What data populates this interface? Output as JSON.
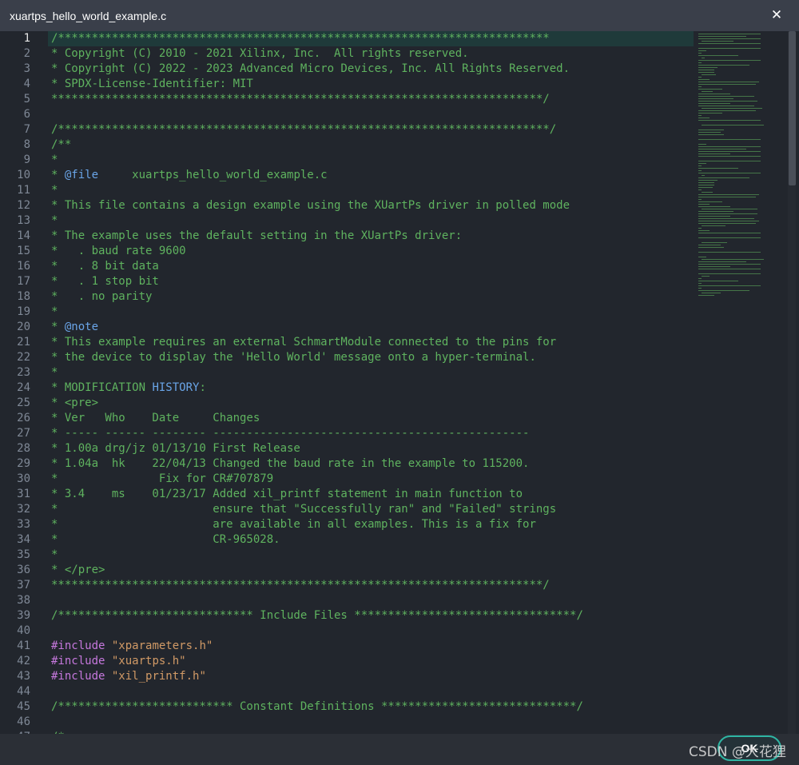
{
  "window": {
    "title": "xuartps_hello_world_example.c",
    "close_icon": "close-icon"
  },
  "editor": {
    "current_line": 1,
    "lines": [
      [
        {
          "t": "/*************************************************************************",
          "c": "comment"
        }
      ],
      [
        {
          "t": "* Copyright (C) 2010 - 2021 Xilinx, Inc.  All rights reserved.",
          "c": "comment"
        }
      ],
      [
        {
          "t": "* Copyright (C) 2022 - 2023 Advanced Micro Devices, Inc. All Rights Reserved.",
          "c": "comment"
        }
      ],
      [
        {
          "t": "* SPDX-License-Identifier: MIT",
          "c": "comment"
        }
      ],
      [
        {
          "t": "*************************************************************************/",
          "c": "comment"
        }
      ],
      [
        {
          "t": "",
          "c": "comment"
        }
      ],
      [
        {
          "t": "/*************************************************************************/",
          "c": "comment"
        }
      ],
      [
        {
          "t": "/**",
          "c": "comment"
        }
      ],
      [
        {
          "t": "*",
          "c": "comment"
        }
      ],
      [
        {
          "t": "* ",
          "c": "comment"
        },
        {
          "t": "@file",
          "c": "tag"
        },
        {
          "t": "     xuartps_hello_world_example.c",
          "c": "comment"
        }
      ],
      [
        {
          "t": "*",
          "c": "comment"
        }
      ],
      [
        {
          "t": "* This file contains a design example using the XUartPs driver in polled mode",
          "c": "comment"
        }
      ],
      [
        {
          "t": "*",
          "c": "comment"
        }
      ],
      [
        {
          "t": "* The example uses the default setting in the XUartPs driver:",
          "c": "comment"
        }
      ],
      [
        {
          "t": "*   . baud rate 9600",
          "c": "comment"
        }
      ],
      [
        {
          "t": "*   . 8 bit data",
          "c": "comment"
        }
      ],
      [
        {
          "t": "*   . 1 stop bit",
          "c": "comment"
        }
      ],
      [
        {
          "t": "*   . no parity",
          "c": "comment"
        }
      ],
      [
        {
          "t": "*",
          "c": "comment"
        }
      ],
      [
        {
          "t": "* ",
          "c": "comment"
        },
        {
          "t": "@note",
          "c": "tag"
        }
      ],
      [
        {
          "t": "* This example requires an external SchmartModule connected to the pins for",
          "c": "comment"
        }
      ],
      [
        {
          "t": "* the device to display the 'Hello World' message onto a hyper-terminal.",
          "c": "comment"
        }
      ],
      [
        {
          "t": "*",
          "c": "comment"
        }
      ],
      [
        {
          "t": "* MODIFICATION ",
          "c": "comment"
        },
        {
          "t": "HISTORY",
          "c": "tag"
        },
        {
          "t": ":",
          "c": "comment"
        }
      ],
      [
        {
          "t": "* <pre>",
          "c": "comment"
        }
      ],
      [
        {
          "t": "* Ver   Who    Date     Changes",
          "c": "comment"
        }
      ],
      [
        {
          "t": "* ----- ------ -------- -----------------------------------------------",
          "c": "comment"
        }
      ],
      [
        {
          "t": "* 1.00a drg/jz 01/13/10 First Release",
          "c": "comment"
        }
      ],
      [
        {
          "t": "* 1.04a  hk    22/04/13 Changed the baud rate in the example to 115200.",
          "c": "comment"
        }
      ],
      [
        {
          "t": "*               Fix for CR#707879",
          "c": "comment"
        }
      ],
      [
        {
          "t": "* 3.4    ms    01/23/17 Added xil_printf statement in main function to",
          "c": "comment"
        }
      ],
      [
        {
          "t": "*                       ensure that \"Successfully ran\" and \"Failed\" strings",
          "c": "comment"
        }
      ],
      [
        {
          "t": "*                       are available in all examples. This is a fix for",
          "c": "comment"
        }
      ],
      [
        {
          "t": "*                       CR-965028.",
          "c": "comment"
        }
      ],
      [
        {
          "t": "*",
          "c": "comment"
        }
      ],
      [
        {
          "t": "* </pre>",
          "c": "comment"
        }
      ],
      [
        {
          "t": "*************************************************************************/",
          "c": "comment"
        }
      ],
      [
        {
          "t": "",
          "c": "comment"
        }
      ],
      [
        {
          "t": "/***************************** Include Files *********************************/",
          "c": "comment"
        }
      ],
      [
        {
          "t": "",
          "c": "comment"
        }
      ],
      [
        {
          "t": "#include",
          "c": "pp"
        },
        {
          "t": " \"xparameters.h\"",
          "c": "str"
        }
      ],
      [
        {
          "t": "#include",
          "c": "pp"
        },
        {
          "t": " \"xuartps.h\"",
          "c": "str"
        }
      ],
      [
        {
          "t": "#include",
          "c": "pp"
        },
        {
          "t": " \"xil_printf.h\"",
          "c": "str"
        }
      ],
      [
        {
          "t": "",
          "c": "comment"
        }
      ],
      [
        {
          "t": "/************************** Constant Definitions *****************************/",
          "c": "comment"
        }
      ],
      [
        {
          "t": "",
          "c": "comment"
        }
      ],
      [
        {
          "t": "/*",
          "c": "comment"
        }
      ]
    ]
  },
  "footer": {
    "ok_label": "OK",
    "watermark": "CSDN @大花狸"
  },
  "colors": {
    "comment": "#5fb35f",
    "tag": "#6aa5e8",
    "preprocessor": "#c678dd",
    "string": "#d19a66",
    "accent": "#2fb6a4"
  }
}
